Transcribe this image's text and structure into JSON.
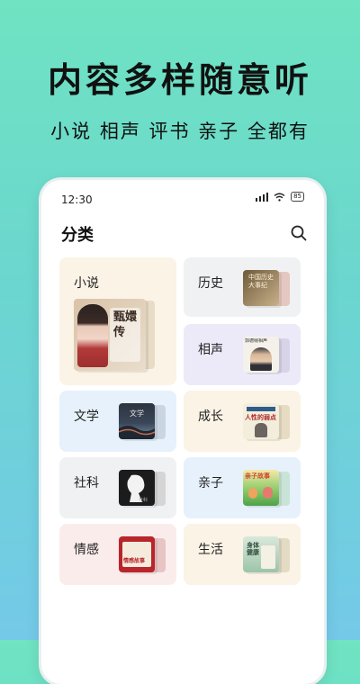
{
  "headline": "内容多样随意听",
  "subline": "小说 相声 评书 亲子 全都有",
  "status": {
    "time": "12:30",
    "battery": "85"
  },
  "app": {
    "title": "分类"
  },
  "categories": [
    {
      "label": "小说",
      "cover_text": "甄嬛传",
      "color": "#FBF3E6"
    },
    {
      "label": "历史",
      "cover_text": "中国历史大事纪",
      "color": "#F0F1F3"
    },
    {
      "label": "相声",
      "cover_text": "郭德纲相声",
      "color": "#ECEAF8"
    },
    {
      "label": "文学",
      "cover_text": "文学",
      "color": "#E6F1FB"
    },
    {
      "label": "成长",
      "cover_text": "人性的弱点",
      "color": "#FBF3E6"
    },
    {
      "label": "社科",
      "cover_text": "社科",
      "color": "#F0F1F3"
    },
    {
      "label": "亲子",
      "cover_text": "亲子故事",
      "color": "#E6F1FB"
    },
    {
      "label": "情感",
      "cover_text": "情感故事",
      "color": "#FBECEC"
    },
    {
      "label": "生活",
      "cover_text": "身体健康",
      "color": "#FBF3E6"
    }
  ]
}
